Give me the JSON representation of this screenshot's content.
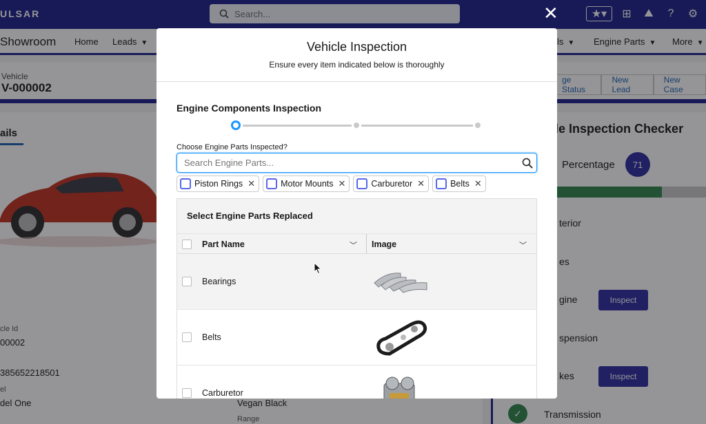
{
  "app": {
    "logo": "ULSAR",
    "global_search_placeholder": "Search...",
    "app_name": "Showroom",
    "nav_items": [
      "Home",
      "Leads",
      "ls",
      "Engine Parts",
      "More"
    ]
  },
  "record": {
    "type": "Vehicle",
    "name": "V-000002",
    "actions": [
      "ge Status",
      "New Lead",
      "New Case"
    ]
  },
  "details": {
    "tab": "ails",
    "fields": [
      {
        "label": "cle Id",
        "value": "00002"
      },
      {
        "label": "",
        "value": "385652218501"
      },
      {
        "label": "el",
        "value": "del One"
      }
    ],
    "color_value": "Vegan Black",
    "range_label": "Range"
  },
  "checker": {
    "title": "cle Inspection Checker",
    "percentage_label": "Percentage",
    "percentage_value": "71",
    "progress_percent": 71,
    "items": [
      {
        "label": "terior",
        "button": ""
      },
      {
        "label": "es",
        "button": ""
      },
      {
        "label": "gine",
        "button": "Inspect"
      },
      {
        "label": "spension",
        "button": ""
      },
      {
        "label": "kes",
        "button": "Inspect"
      },
      {
        "label": "Transmission",
        "button": ""
      }
    ]
  },
  "modal": {
    "title": "Vehicle Inspection",
    "subtitle": "Ensure every item indicated below is thoroughly",
    "section_title": "Engine Components Inspection",
    "field_label": "Choose Engine Parts Inspected?",
    "search_placeholder": "Search Engine Parts...",
    "selected_pills": [
      "Piston Rings",
      "Motor Mounts",
      "Carburetor",
      "Belts"
    ],
    "table": {
      "caption": "Select Engine Parts Replaced",
      "columns": [
        "Part Name",
        "Image"
      ],
      "rows": [
        {
          "name": "Bearings",
          "image_icon": "bearings-image"
        },
        {
          "name": "Belts",
          "image_icon": "belt-image"
        },
        {
          "name": "Carburetor",
          "image_icon": "carburetor-image"
        }
      ]
    }
  },
  "colors": {
    "brand_navy": "#1b1f8a",
    "accent_blue": "#1b96ff",
    "button_indigo": "#2a2ba0",
    "success_green": "#2e844a"
  }
}
